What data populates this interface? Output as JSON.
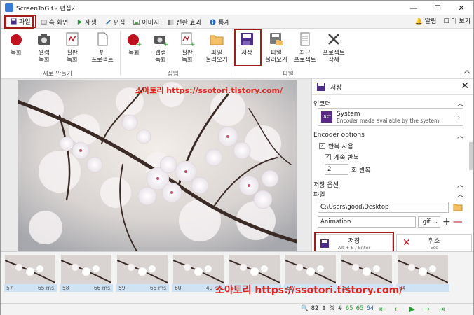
{
  "window": {
    "title": "ScreenToGif - 편집기",
    "min": "—",
    "max": "☐",
    "close": "✕"
  },
  "tabs": [
    {
      "label": "파일",
      "active": true
    },
    {
      "label": "홈 화면"
    },
    {
      "label": "재생"
    },
    {
      "label": "편집"
    },
    {
      "label": "이미지"
    },
    {
      "label": "전환 효과"
    },
    {
      "label": "통계"
    }
  ],
  "tabs_right": {
    "alerts": "알림",
    "more": "더 보기"
  },
  "ribbon": {
    "buttons": [
      {
        "label1": "녹화",
        "label2": ""
      },
      {
        "label1": "웹캠",
        "label2": "녹화"
      },
      {
        "label1": "칠판",
        "label2": "녹화"
      },
      {
        "label1": "빈",
        "label2": "프로젝트"
      },
      {
        "label1": "녹화",
        "label2": ""
      },
      {
        "label1": "웹캠",
        "label2": "녹화"
      },
      {
        "label1": "칠판",
        "label2": "녹화"
      },
      {
        "label1": "파일",
        "label2": "불러오기"
      },
      {
        "label1": "저장",
        "label2": ""
      },
      {
        "label1": "파일",
        "label2": "불러오기"
      },
      {
        "label1": "최근",
        "label2": "프로젝트"
      },
      {
        "label1": "프로젝트",
        "label2": "삭제"
      }
    ],
    "groups": {
      "new": "새로 만들기",
      "insert": "삽입",
      "file": "파일"
    }
  },
  "canvas_watermark": "소아토리 https://ssotori.tistory.com/",
  "panel": {
    "title": "저장",
    "encoder_header": "인코더",
    "encoder_name": "System",
    "encoder_desc": "Encoder made available by the system.",
    "encoder_icon": ".NET",
    "options_header": "Encoder options",
    "loop": "반복 사용",
    "loop_forever": "계속 반복",
    "repeat_count": "2",
    "repeat_label": "회 반복",
    "save_options_header": "저장 옵션",
    "file_header": "파일",
    "folder": "C:\\Users\\good\\Desktop",
    "filename": "Animation",
    "extension": ".gif",
    "save_btn": "저장",
    "save_shortcut": "Alt + E / Enter",
    "cancel_btn": "취소",
    "cancel_shortcut": "Esc"
  },
  "frames": [
    {
      "num": "57",
      "ms": "65 ms"
    },
    {
      "num": "58",
      "ms": "66 ms"
    },
    {
      "num": "59",
      "ms": "65 ms"
    },
    {
      "num": "60",
      "ms": "49 ms"
    },
    {
      "num": "61",
      "ms": ""
    },
    {
      "num": "62",
      "ms": ""
    },
    {
      "num": "63",
      "ms": ""
    },
    {
      "num": "64",
      "ms": ""
    }
  ],
  "footer_watermark": "소아토리 https://ssotori.tistory.com/",
  "status": {
    "zoom": "82",
    "percent": "%",
    "total": "65",
    "selected": "65",
    "current": "64"
  },
  "colors": {
    "accent": "#a31c1c",
    "record": "#c0111f",
    "save": "#4b2f86",
    "green": "#2e9a37"
  }
}
